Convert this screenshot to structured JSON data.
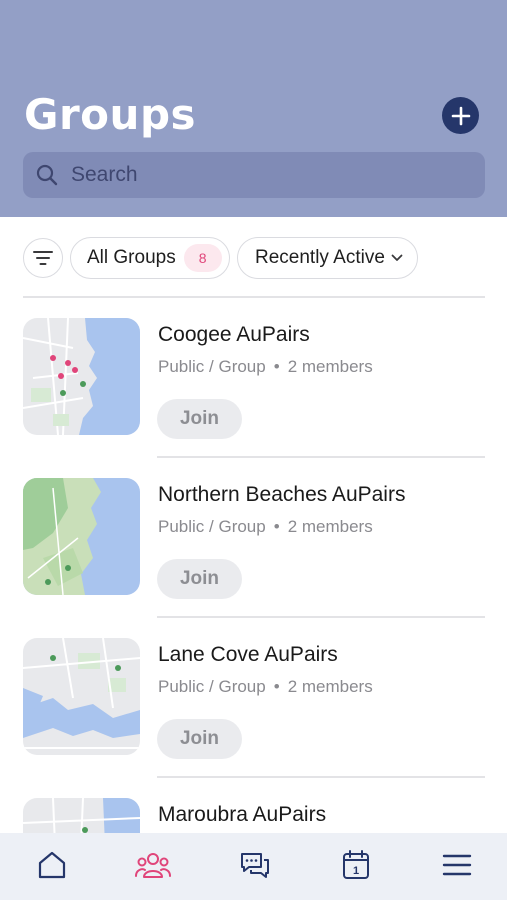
{
  "header": {
    "title": "Groups",
    "bg_color": "#939fc6",
    "add_icon": "plus-icon"
  },
  "search": {
    "placeholder": "Search",
    "icon": "search-icon"
  },
  "filters": {
    "filter_icon": "filter-icon",
    "all_groups_label": "All Groups",
    "all_groups_count": "8",
    "sort_label": "Recently Active",
    "sort_icon": "chevron-down-icon"
  },
  "groups": [
    {
      "name": "Coogee AuPairs",
      "type": "Public / Group",
      "members": "2 members",
      "join_label": "Join"
    },
    {
      "name": "Northern Beaches AuPairs",
      "type": "Public / Group",
      "members": "2 members",
      "join_label": "Join"
    },
    {
      "name": "Lane Cove AuPairs",
      "type": "Public / Group",
      "members": "2 members",
      "join_label": "Join"
    },
    {
      "name": "Maroubra AuPairs",
      "type": "",
      "members": "",
      "join_label": ""
    }
  ],
  "tabbar": {
    "items": [
      {
        "icon": "home-icon",
        "active": false
      },
      {
        "icon": "groups-icon",
        "active": true
      },
      {
        "icon": "chat-icon",
        "active": false
      },
      {
        "icon": "calendar-icon",
        "active": false,
        "day": "1"
      },
      {
        "icon": "menu-icon",
        "active": false
      }
    ],
    "active_color": "#e0457a",
    "inactive_color": "#25366a"
  }
}
